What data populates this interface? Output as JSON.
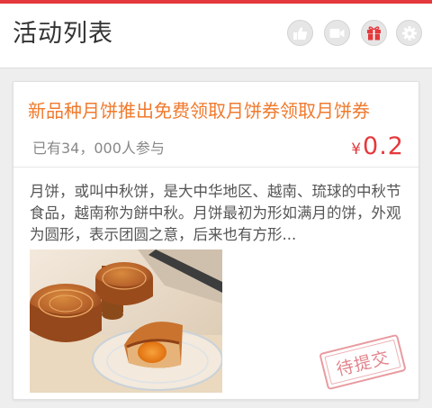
{
  "header": {
    "title": "活动列表",
    "icons": [
      "thumbs-up-icon",
      "video-camera-icon",
      "gift-icon",
      "gear-icon"
    ],
    "accent_color": "#e4393c"
  },
  "activity": {
    "title": "新品种月饼推出免费领取月饼券领取月饼券",
    "participants": "已有34，000人参与",
    "currency": "¥",
    "price": "0.2",
    "description": "月饼，或叫中秋饼，是大中华地区、越南、琉球的中秋节食品，越南称为餅中秋。月饼最初为形如满月的饼，外观为圆形，表示团圆之意，后来也有方形...",
    "status_stamp": "待提交",
    "title_color": "#f07a2d",
    "price_color": "#e4393c"
  }
}
